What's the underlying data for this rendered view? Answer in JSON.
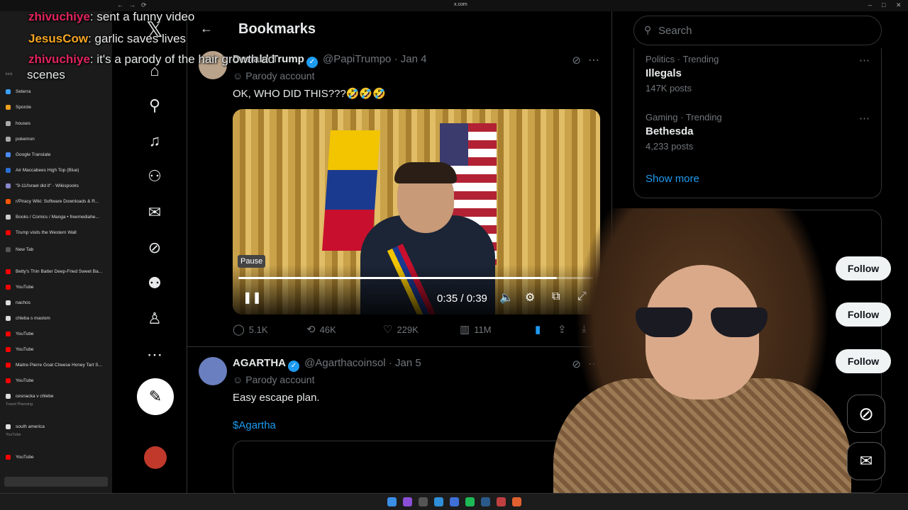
{
  "browser": {
    "url": "x.com",
    "sidebar": {
      "items": [
        {
          "label": "Seterra",
          "color": "#3aa0ff"
        },
        {
          "label": "Sporcle",
          "color": "#f0a020"
        },
        {
          "label": "houses",
          "color": "#aaaaaa"
        },
        {
          "label": "pokemon",
          "color": "#aaaaaa"
        },
        {
          "label": "Google Translate",
          "color": "#4a8af4"
        },
        {
          "label": "Air Maccabees High Top (Blue)",
          "color": "#2a6fd6"
        },
        {
          "label": "\"9-11/Israel did it\" - Wikispooks",
          "color": "#8888cc"
        },
        {
          "label": "r/Piracy Wiki: Software Downloads & R...",
          "color": "#ff5700"
        },
        {
          "label": "Books / Comics / Manga • freemediahe...",
          "color": "#cccccc"
        },
        {
          "label": "Trump visits the Western Wall",
          "color": "#ff0000"
        },
        {
          "label": "New Tab",
          "color": "#555555"
        },
        {
          "label": "Betty's Thin Batter Deep-Fried Sweet Ba...",
          "color": "#ff0000"
        },
        {
          "label": "YouTube",
          "color": "#ff0000"
        },
        {
          "label": "nachos",
          "color": "#dddddd"
        },
        {
          "label": "chleba s maslom",
          "color": "#dddddd"
        },
        {
          "label": "YouTube",
          "color": "#ff0000"
        },
        {
          "label": "YouTube",
          "color": "#ff0000"
        },
        {
          "label": "Maitre Pierre Goat Cheese Honey Tart S...",
          "color": "#ff0000"
        },
        {
          "label": "YouTube",
          "color": "#ff0000"
        },
        {
          "label": "cesnacka v chlebe",
          "color": "#dddddd"
        },
        {
          "label": "south america",
          "color": "#dddddd"
        },
        {
          "label": "YouTube",
          "color": "#ff0000"
        }
      ],
      "sections": {
        "travel": "Travel Planning",
        "youtube": "YouTube",
        "kick": "kick"
      }
    }
  },
  "chat": [
    {
      "user": "zhivuchiye",
      "user_color": "#e0245e",
      "message": "sent a funny video"
    },
    {
      "user": "JesusCow",
      "user_color": "#f5a623",
      "message": "garlic saves lives"
    },
    {
      "user": "zhivuchiye",
      "user_color": "#e0245e",
      "message": "it's a parody of the hair growth ad"
    },
    {
      "user": "",
      "user_color": "#ffffff",
      "message": "scenes"
    }
  ],
  "x": {
    "page_title": "Bookmarks",
    "tweets": [
      {
        "name": "Donald Trump",
        "handle": "@PapiTrumpo",
        "date": "Jan 4",
        "badge": "Parody account",
        "text": "OK, WHO DID THIS???🤣🤣🤣",
        "video": {
          "tooltip": "Pause",
          "time": "0:35 / 0:39",
          "progress": 0.897
        },
        "stats": {
          "replies": "5.1K",
          "reposts": "46K",
          "likes": "229K",
          "views": "11M"
        }
      },
      {
        "name": "AGARTHA",
        "handle": "@Agarthacoinsol",
        "date": "Jan 5",
        "badge": "Parody account",
        "text": "Easy escape plan.",
        "cashtag": "$Agartha"
      }
    ],
    "right": {
      "search_placeholder": "Search",
      "trends": [
        {
          "category": "Politics · Trending",
          "name": "Illegals",
          "count": "147K posts"
        },
        {
          "category": "Gaming · Trending",
          "name": "Bethesda",
          "count": "4,233 posts"
        }
      ],
      "show_more": "Show more",
      "follow_label": "Follow"
    }
  }
}
